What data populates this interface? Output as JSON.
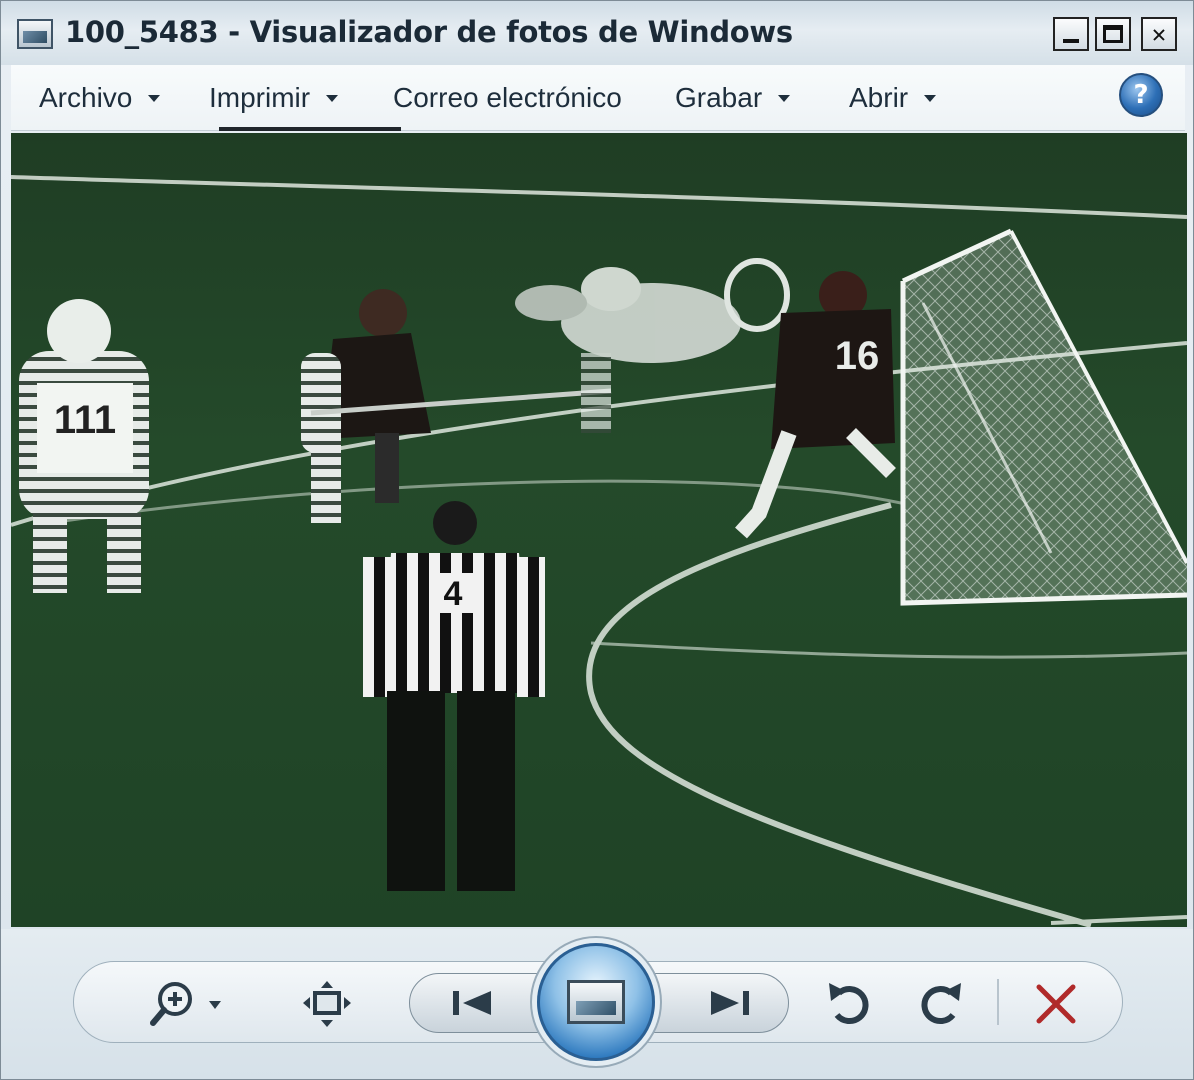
{
  "window": {
    "title": "100_5483 - Visualizador de fotos de Windows",
    "controls": {
      "minimize": "minimize-icon",
      "maximize": "maximize-icon",
      "close": "✕"
    }
  },
  "menu": {
    "items": [
      {
        "label": "Archivo",
        "has_dropdown": true
      },
      {
        "label": "Imprimir",
        "has_dropdown": true
      },
      {
        "label": "Correo electrónico",
        "has_dropdown": false
      },
      {
        "label": "Grabar",
        "has_dropdown": true
      },
      {
        "label": "Abrir",
        "has_dropdown": true
      }
    ],
    "help_glyph": "?"
  },
  "photo": {
    "jersey_numbers": {
      "referee": "4",
      "goalie": "16",
      "left_player": "111"
    }
  },
  "toolbar": {
    "icons": [
      "zoom-icon",
      "fit-to-window-icon",
      "previous-icon",
      "slideshow-icon",
      "next-icon",
      "rotate-counterclockwise-icon",
      "rotate-clockwise-icon",
      "delete-icon"
    ],
    "delete_color": "#b02a2a",
    "accent_color": "#2c78be"
  }
}
